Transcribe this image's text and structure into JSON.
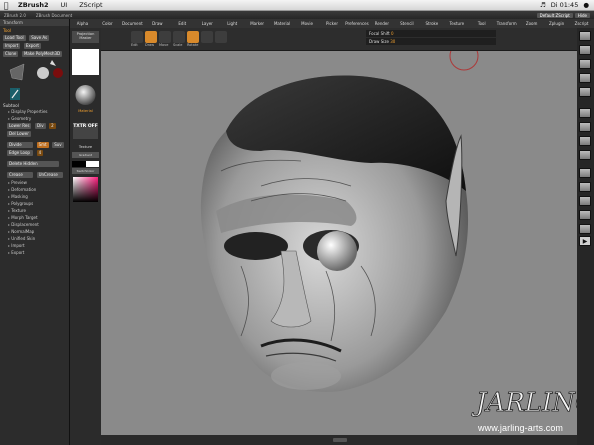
{
  "menubar": {
    "app": "ZBrush2",
    "items": [
      "UI",
      "ZScript"
    ],
    "clock": "Di 01:45"
  },
  "titlebar": {
    "title": "ZBrush 2.0",
    "document": "ZBrush Document",
    "btns": [
      "Default ZScript",
      "Hide"
    ]
  },
  "topmenu": [
    "Alpha",
    "Color",
    "Document",
    "Draw",
    "Edit",
    "Layer",
    "Light",
    "Marker",
    "Material",
    "Movie",
    "Picker",
    "Preferences",
    "Render",
    "Stencil",
    "Stroke",
    "Texture",
    "Tool",
    "Transform",
    "Zoom",
    "Zplugin",
    "Zscript"
  ],
  "left": {
    "header": "Transform",
    "tool_label": "Tool",
    "buttons_row1": [
      "Load Tool",
      "Save As"
    ],
    "buttons_row2": [
      "Import",
      "Export"
    ],
    "buttons_row3": [
      "Clone",
      "Make PolyMesh3D"
    ],
    "subtool_label": "Subtool",
    "items": [
      "Display Properties",
      "Geometry",
      "Lower Res",
      "Div",
      "Del Lower",
      "Divide",
      "Smt",
      "Suv",
      "Edge Loop",
      "Delete Hidden",
      "Crease",
      "UnCrease",
      "Preview",
      "Deformation",
      "Masking",
      "Polygroups",
      "Texture",
      "Morph Target",
      "Displacement",
      "NormalMap",
      "Unified Skin",
      "Import",
      "Export"
    ],
    "div_value": "2",
    "sub_value": "4"
  },
  "mid": {
    "projection_label": "Projection Master",
    "material_label": "Material",
    "texture_label": "Texture",
    "txtr_off": "TXTR OFF",
    "gradient_label": "SwitchColor"
  },
  "shelf": {
    "buttons": [
      "Edit",
      "Draw",
      "Move",
      "Scale",
      "Rotate"
    ],
    "focal_label": "Focal Shift",
    "focal_value": "0",
    "draw_label": "Draw Size",
    "draw_value": "30"
  },
  "right": {
    "icons": [
      "Scroll",
      "Zoom",
      "Actual",
      "AAHalf",
      "Persp",
      "Floor",
      "Local",
      "L.Sym",
      "Xyz",
      "Frame",
      "Move",
      "Scale",
      "Rotate",
      "Transp",
      "Ghost"
    ]
  },
  "watermark": {
    "brand": "JARLING",
    "url": "www.jarling-arts.com"
  },
  "colors": {
    "accent": "#f0a030",
    "canvas": "#8a8a8a",
    "panel": "#2c2c2c"
  }
}
